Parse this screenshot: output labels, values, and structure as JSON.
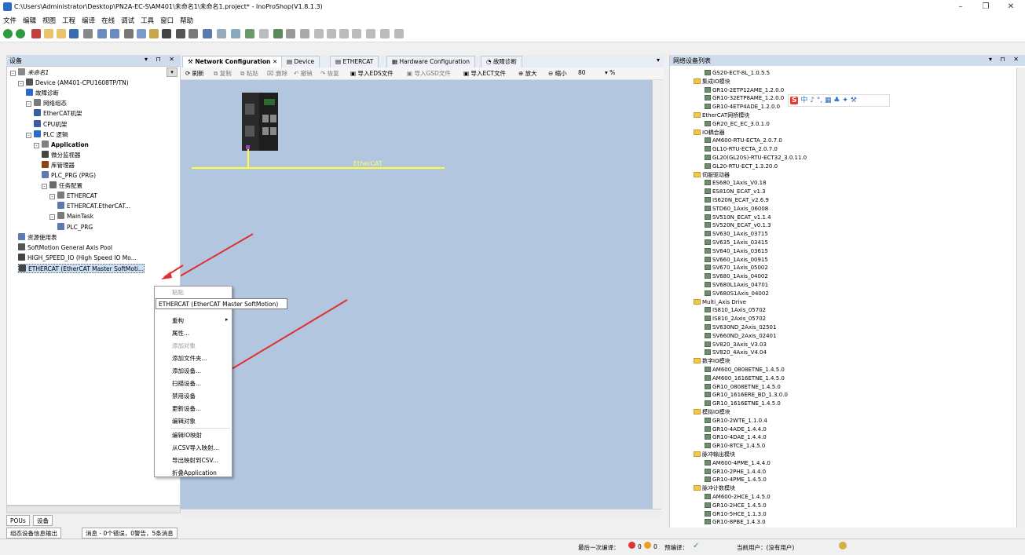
{
  "window": {
    "title": "C:\\Users\\Administrator\\Desktop\\PN2A-EC-S\\AM401\\未命名1\\未命名1.project* - InoProShop(V1.8.1.3)",
    "minimize": "–",
    "restore": "❐",
    "close": "✕"
  },
  "menu": [
    "文件",
    "编辑",
    "视图",
    "工程",
    "编译",
    "在线",
    "调试",
    "工具",
    "窗口",
    "帮助"
  ],
  "left_panel": {
    "title": "设备",
    "controls": "▾ ⊓ ✕",
    "tree": [
      {
        "label": "未命名1",
        "indent": 0,
        "exp": "⊟",
        "color": "#888"
      },
      {
        "label": "Device (AM401-CPU1608TP/TN)",
        "indent": 1,
        "exp": "⊟",
        "color": "#555"
      },
      {
        "label": "故障诊断",
        "indent": 2,
        "exp": "",
        "color": "#2a6cc4"
      },
      {
        "label": "网络组态",
        "indent": 2,
        "exp": "⊟",
        "color": "#7a7a7a"
      },
      {
        "label": "EtherCAT机架",
        "indent": 3,
        "exp": "",
        "color": "#3a5fa0"
      },
      {
        "label": "CPU机架",
        "indent": 3,
        "exp": "",
        "color": "#3a5fa0"
      },
      {
        "label": "PLC 逻辑",
        "indent": 2,
        "exp": "⊟",
        "color": "#2a6cc4"
      },
      {
        "label": "Application",
        "indent": 3,
        "exp": "⊟",
        "color": "#808080",
        "bold": true
      },
      {
        "label": "微分监视器",
        "indent": 4,
        "exp": "",
        "color": "#444"
      },
      {
        "label": "库管理器",
        "indent": 4,
        "exp": "",
        "color": "#8b4513"
      },
      {
        "label": "PLC_PRG (PRG)",
        "indent": 4,
        "exp": "",
        "color": "#5a7ab0"
      },
      {
        "label": "任务配置",
        "indent": 4,
        "exp": "⊟",
        "color": "#6a6a6a"
      },
      {
        "label": "ETHERCAT",
        "indent": 5,
        "exp": "⊟",
        "color": "#7a7a7a"
      },
      {
        "label": "ETHERCAT.EtherCAT...",
        "indent": 6,
        "exp": "",
        "color": "#5a7ab0"
      },
      {
        "label": "MainTask",
        "indent": 5,
        "exp": "⊟",
        "color": "#7a7a7a"
      },
      {
        "label": "PLC_PRG",
        "indent": 6,
        "exp": "",
        "color": "#5a7ab0"
      },
      {
        "label": "资源使用表",
        "indent": 1,
        "exp": "",
        "color": "#5a7ab0"
      },
      {
        "label": "SoftMotion General Axis Pool",
        "indent": 1,
        "exp": "",
        "color": "#555"
      },
      {
        "label": "HIGH_SPEED_IO (High Speed IO Mo...",
        "indent": 1,
        "exp": "",
        "color": "#444"
      },
      {
        "label": "ETHERCAT (EtherCAT Master SoftMoti...",
        "indent": 1,
        "exp": "",
        "color": "#444",
        "selected": true
      }
    ]
  },
  "tabs": [
    {
      "label": "Network Configuration",
      "active": true
    },
    {
      "label": "Device"
    },
    {
      "label": "ETHERCAT"
    },
    {
      "label": "Hardware Configuration"
    },
    {
      "label": "故障诊断"
    }
  ],
  "doc_toolbar": [
    "刷新",
    "复制",
    "粘贴",
    "删除",
    "撤销",
    "恢复",
    "导入EDS文件",
    "导入GSD文件",
    "导入ECT文件",
    "放大",
    "缩小"
  ],
  "zoom_value": "80",
  "zoom_unit": "%",
  "canvas": {
    "bus_label": "EtherCAT"
  },
  "context_menu": {
    "tooltip": "ETHERCAT (EtherCAT Master SoftMotion)",
    "items": [
      {
        "label": "粘贴",
        "disabled": true
      },
      {
        "label": "重构",
        "sub": true
      },
      {
        "label": "属性..."
      },
      {
        "label": "添加对象",
        "disabled": true
      },
      {
        "label": "添加文件夹..."
      },
      {
        "label": "添加设备..."
      },
      {
        "label": "扫描设备..."
      },
      {
        "label": "禁用设备"
      },
      {
        "label": "更新设备..."
      },
      {
        "label": "编辑对象"
      },
      {
        "label": "编辑IO映射"
      },
      {
        "label": "从CSV导入映射..."
      },
      {
        "label": "导出映射到CSV..."
      },
      {
        "label": "折叠Application"
      }
    ]
  },
  "right_panel": {
    "title": "网络设备列表",
    "controls": "▾ ⊓ ✕",
    "tree": [
      {
        "label": "GS20-ECT-8L_1.0.5.5",
        "type": "dev"
      },
      {
        "label": "集成IO模块",
        "type": "folder"
      },
      {
        "label": "GR10-2ETP12AME_1.2.0.0",
        "type": "dev"
      },
      {
        "label": "GR10-32ETP8AME_1.2.0.0",
        "type": "dev"
      },
      {
        "label": "GR10-4ETP4ADE_1.2.0.0",
        "type": "dev"
      },
      {
        "label": "EtherCAT网桥模块",
        "type": "folder"
      },
      {
        "label": "GR20_EC_EC_3.0.1.0",
        "type": "dev"
      },
      {
        "label": "IO耦合器",
        "type": "folder"
      },
      {
        "label": "AM600-RTU-ECTA_2.0.7.0",
        "type": "dev"
      },
      {
        "label": "GL10-RTU-ECTA_2.0.7.0",
        "type": "dev"
      },
      {
        "label": "GL20(GL20S)-RTU-ECT32_3.0.11.0",
        "type": "dev"
      },
      {
        "label": "GL20-RTU-ECT_1.3.20.0",
        "type": "dev"
      },
      {
        "label": "伺服驱动器",
        "type": "folder"
      },
      {
        "label": "ES680_1Axis_V0.18",
        "type": "dev"
      },
      {
        "label": "ES810N_ECAT_v1.3",
        "type": "dev"
      },
      {
        "label": "IS620N_ECAT_v2.6.9",
        "type": "dev"
      },
      {
        "label": "STD60_1Axis_06008",
        "type": "dev"
      },
      {
        "label": "SV510N_ECAT_v1.1.4",
        "type": "dev"
      },
      {
        "label": "SV520N_ECAT_v0.1.3",
        "type": "dev"
      },
      {
        "label": "SV630_1Axis_03715",
        "type": "dev"
      },
      {
        "label": "SV635_1Axis_03415",
        "type": "dev"
      },
      {
        "label": "SV640_1Axis_03615",
        "type": "dev"
      },
      {
        "label": "SV660_1Axis_00915",
        "type": "dev"
      },
      {
        "label": "SV670_1Axis_05002",
        "type": "dev"
      },
      {
        "label": "SV680_1Axis_04002",
        "type": "dev"
      },
      {
        "label": "SV680L1Axis_04701",
        "type": "dev"
      },
      {
        "label": "SV680S1Axis_04002",
        "type": "dev"
      },
      {
        "label": "Multi_Axis Drive",
        "type": "folder"
      },
      {
        "label": "IS810_1Axis_05702",
        "type": "dev"
      },
      {
        "label": "IS810_2Axis_05702",
        "type": "dev"
      },
      {
        "label": "SV630ND_2Axis_02501",
        "type": "dev"
      },
      {
        "label": "SV660ND_2Axis_02401",
        "type": "dev"
      },
      {
        "label": "SV820_3Axis_V3.03",
        "type": "dev"
      },
      {
        "label": "SV820_4Axis_V4.04",
        "type": "dev"
      },
      {
        "label": "数字IO模块",
        "type": "folder"
      },
      {
        "label": "AM600_0808ETNE_1.4.5.0",
        "type": "dev"
      },
      {
        "label": "AM600_1616ETNE_1.4.5.0",
        "type": "dev"
      },
      {
        "label": "GR10_0808ETNE_1.4.5.0",
        "type": "dev"
      },
      {
        "label": "GR10_1616ERE_BD_1.3.0.0",
        "type": "dev"
      },
      {
        "label": "GR10_1616ETNE_1.4.5.0",
        "type": "dev"
      },
      {
        "label": "模拟IO模块",
        "type": "folder"
      },
      {
        "label": "GR10-2WTE_1.1.0.4",
        "type": "dev"
      },
      {
        "label": "GR10-4ADE_1.4.4.0",
        "type": "dev"
      },
      {
        "label": "GR10-4DAE_1.4.4.0",
        "type": "dev"
      },
      {
        "label": "GR10-8TCE_1.4.5.0",
        "type": "dev"
      },
      {
        "label": "脉冲输出模块",
        "type": "folder"
      },
      {
        "label": "AM600-4PME_1.4.4.0",
        "type": "dev"
      },
      {
        "label": "GR10-2PHE_1.4.4.0",
        "type": "dev"
      },
      {
        "label": "GR10-4PME_1.4.5.0",
        "type": "dev"
      },
      {
        "label": "脉冲计数模块",
        "type": "folder"
      },
      {
        "label": "AM600-2HCE_1.4.5.0",
        "type": "dev"
      },
      {
        "label": "GR10-2HCE_1.4.5.0",
        "type": "dev"
      },
      {
        "label": "GR10-5HCE_1.1.3.0",
        "type": "dev"
      },
      {
        "label": "GR10-8PBE_1.4.3.0",
        "type": "dev"
      }
    ]
  },
  "ime_toolbar": {
    "logo": "S",
    "items": "中 ♪ °, ▦ ♣ ✦ ⚒"
  },
  "bottom_tabs": [
    "POUs",
    "设备"
  ],
  "status_tabs": [
    "组态设备信息输出",
    "消息 - 0个错误，0警告，5条消息"
  ],
  "status": {
    "last_compile_label": "最后一次编译：",
    "errors": "0",
    "warnings": "0",
    "precompile_label": "预编译：",
    "precompile_ok": "✓",
    "user": "当前用户：(没有用户)"
  }
}
